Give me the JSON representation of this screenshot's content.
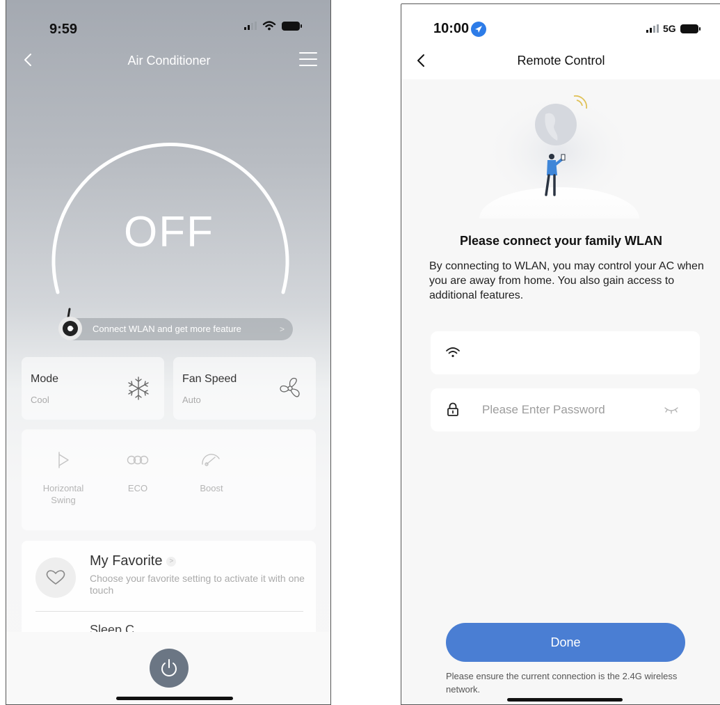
{
  "left_screen": {
    "status_bar": {
      "time": "9:59"
    },
    "nav": {
      "title": "Air Conditioner"
    },
    "power_state": "OFF",
    "wlan_banner": {
      "text": "Connect WLAN and get more feature",
      "arrow": ">"
    },
    "mode_card": {
      "label": "Mode",
      "value": "Cool",
      "icon": "snowflake-icon"
    },
    "fan_card": {
      "label": "Fan Speed",
      "value": "Auto",
      "icon": "fan-icon"
    },
    "features": [
      {
        "label": "Horizontal Swing",
        "icon": "swing-icon"
      },
      {
        "label": "ECO",
        "icon": "eco-icon"
      },
      {
        "label": "Boost",
        "icon": "boost-icon"
      }
    ],
    "favorite": {
      "title": "My Favorite",
      "description": "Choose your favorite setting to activate it with one touch",
      "chevron": ">",
      "next_item_partial": "Sleep C..."
    }
  },
  "right_screen": {
    "status_bar": {
      "time": "10:00",
      "network": "5G"
    },
    "nav": {
      "title": "Remote Control"
    },
    "heading": "Please connect your family WLAN",
    "body": "By connecting to WLAN, you may control your AC when you are away from home. You also gain access to additional features.",
    "wifi_field": {
      "value": "",
      "icon": "wifi-icon"
    },
    "password_field": {
      "placeholder": "Please Enter Password",
      "icon": "lock-icon"
    },
    "done_label": "Done",
    "note": "Please ensure the current connection is the 2.4G wireless network.",
    "accent_color": "#4a7ed3"
  }
}
